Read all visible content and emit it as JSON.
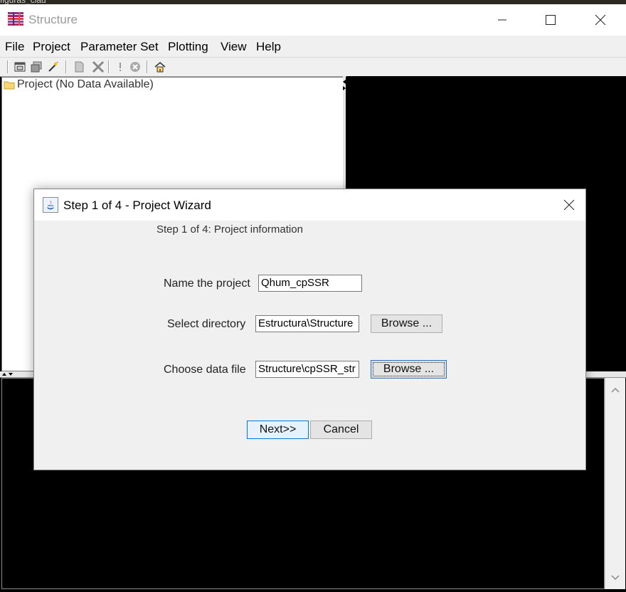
{
  "desktop": {
    "background_text": "figuras_clau"
  },
  "window": {
    "title": "Structure",
    "menu": [
      "File",
      "Project",
      "Parameter Set",
      "Plotting",
      "View",
      "Help"
    ],
    "toolbar_icons": [
      "open-project-icon",
      "copy-icon",
      "wand-icon",
      "new-parameter-set-icon",
      "delete-icon",
      "run-icon",
      "stop-icon",
      "home-icon"
    ],
    "tree": {
      "root_label": "Project (No Data Available)",
      "root_icon": "folder-icon"
    }
  },
  "dialog": {
    "title": "Step 1 of 4 - Project Wizard",
    "step_label": "Step 1 of 4: Project information",
    "fields": {
      "project_name": {
        "label": "Name the project",
        "value": "Qhum_cpSSR"
      },
      "directory": {
        "label": "Select directory",
        "value": "Estructura\\Structure",
        "browse_label": "Browse ..."
      },
      "data_file": {
        "label": "Choose data file",
        "value": "Structure\\cpSSR_str",
        "browse_label": "Browse ..."
      }
    },
    "next_label": "Next>>",
    "cancel_label": "Cancel"
  },
  "colors": {
    "accent": "#0078d7",
    "plot_background": "#000000",
    "dialog_background": "#f0f0f0"
  }
}
